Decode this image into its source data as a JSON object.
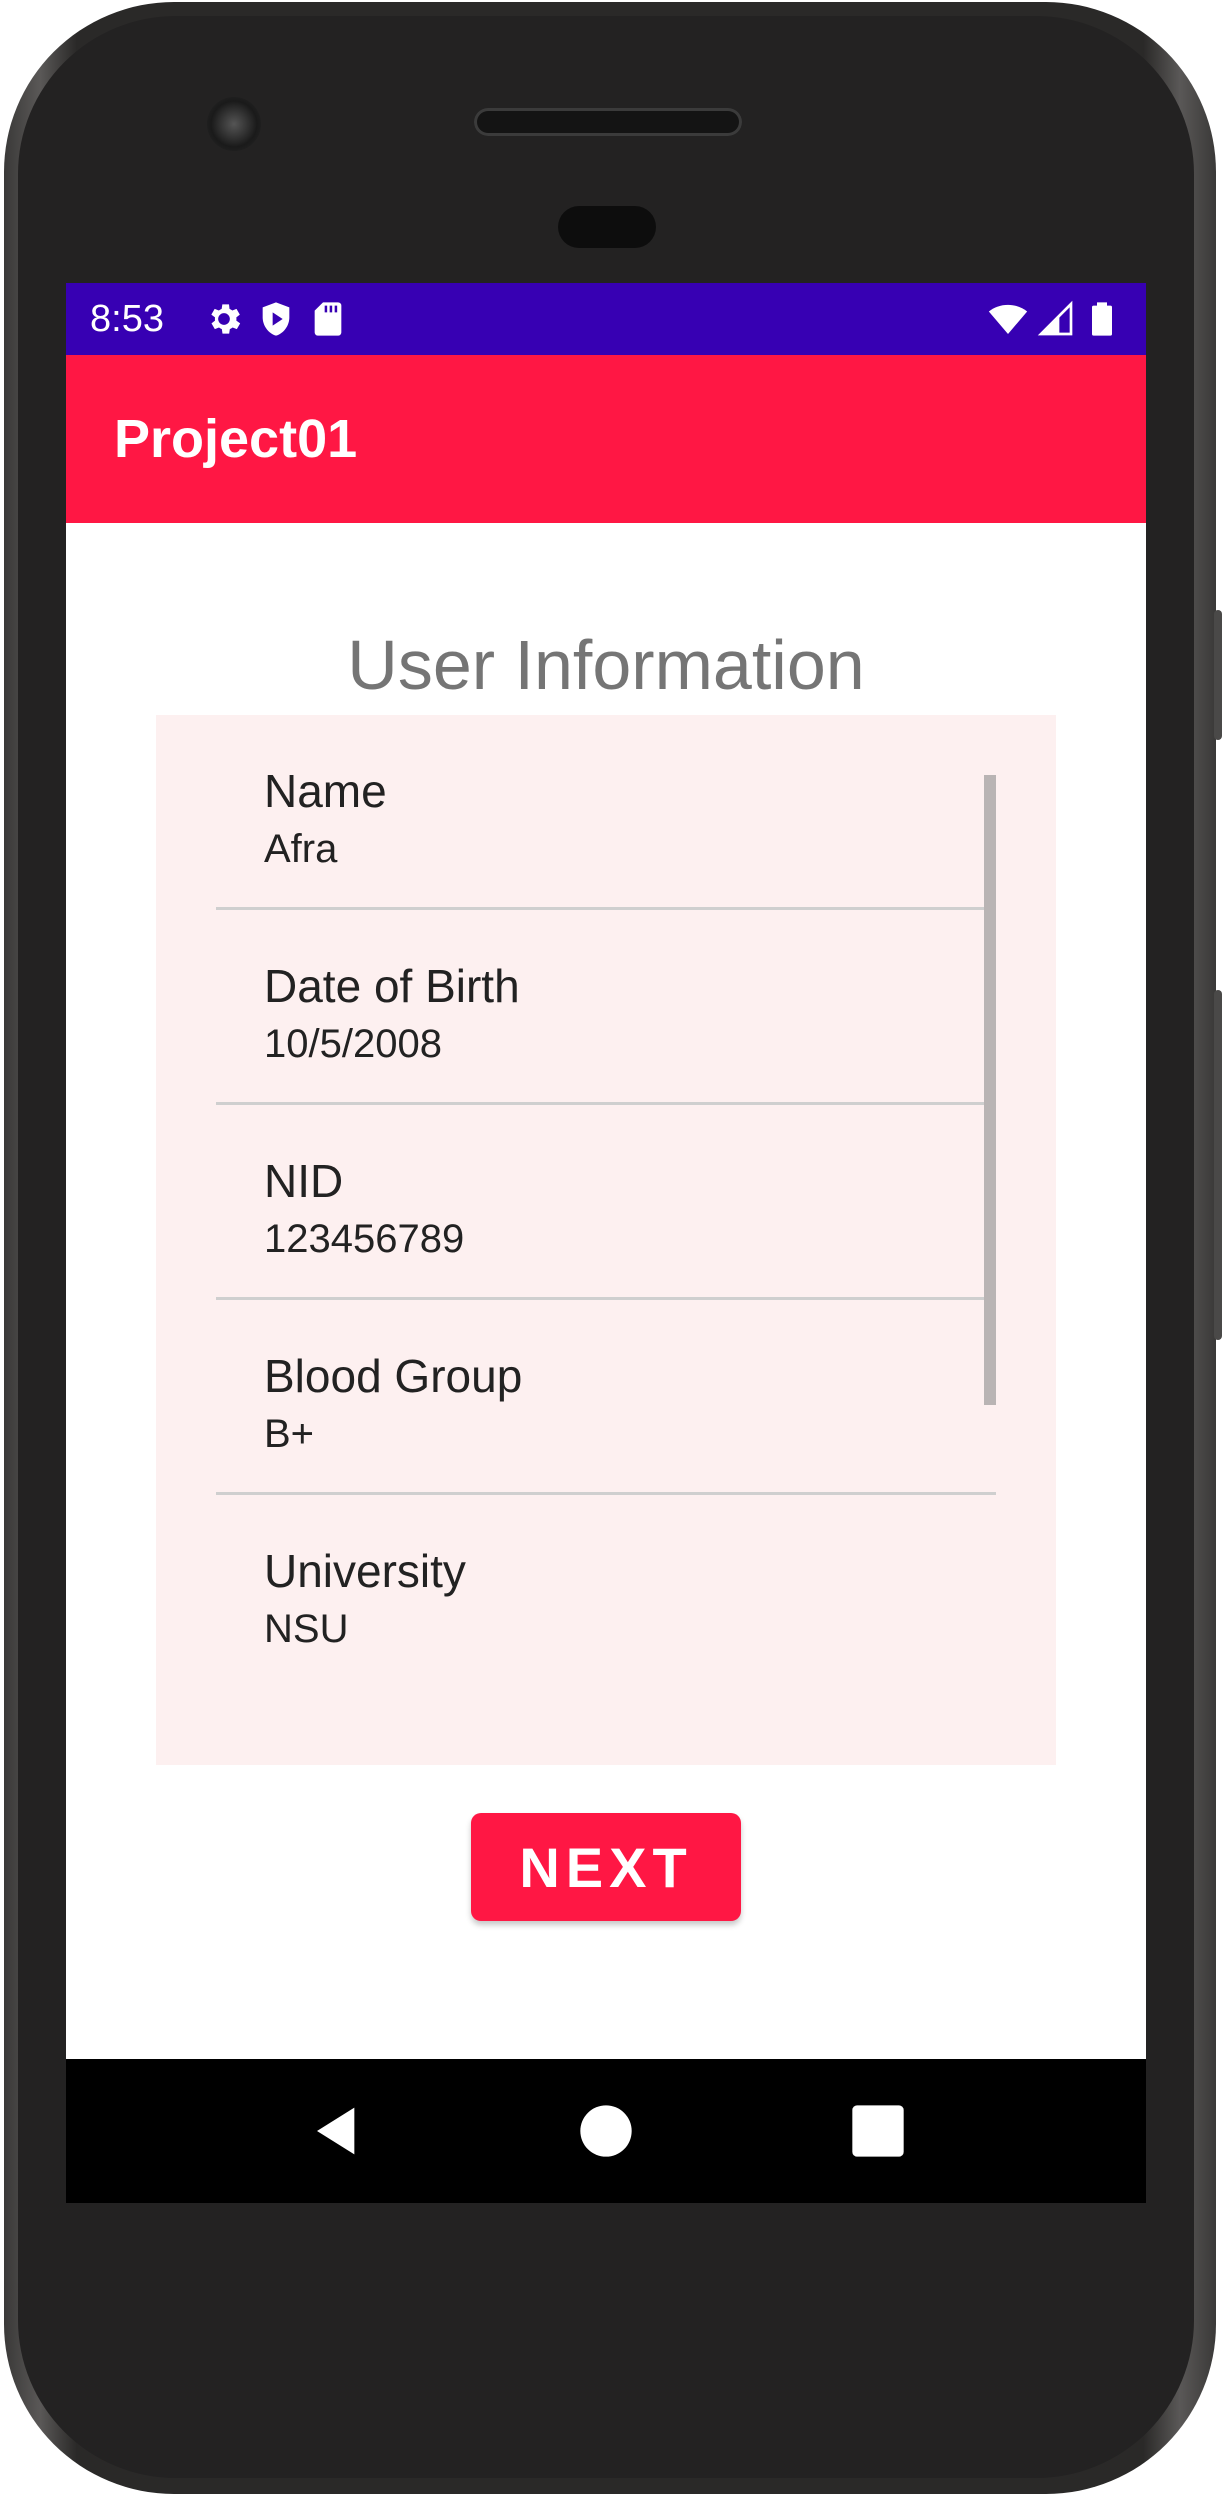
{
  "status_bar": {
    "time": "8:53",
    "left_icons": [
      "gear-icon",
      "shield-play-icon",
      "sd-card-icon"
    ],
    "right_icons": [
      "wifi-icon",
      "signal-icon",
      "battery-icon"
    ],
    "color": "#3700b3"
  },
  "app_bar": {
    "title": "Project01",
    "color": "#ff1744"
  },
  "main": {
    "heading": "User Information",
    "fields": [
      {
        "label": "Name",
        "value": "Afra"
      },
      {
        "label": "Date of Birth",
        "value": "10/5/2008"
      },
      {
        "label": "NID",
        "value": "123456789"
      },
      {
        "label": "Blood Group",
        "value": "B+"
      },
      {
        "label": "University",
        "value": "NSU"
      }
    ],
    "card_color": "#fdf0f0"
  },
  "next_button": {
    "label": "NEXT",
    "color": "#ff1744"
  },
  "nav_bar": {
    "icons": [
      "back-icon",
      "home-icon",
      "recents-icon"
    ]
  }
}
